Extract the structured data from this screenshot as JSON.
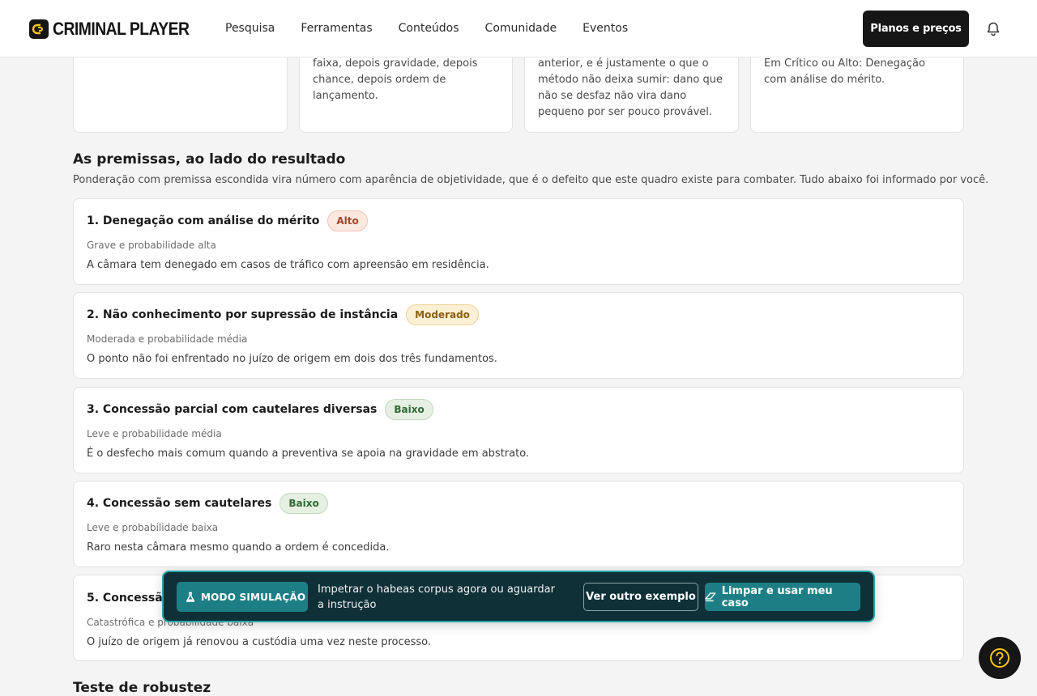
{
  "header": {
    "brand": "CRIMINAL PLAYER",
    "nav": [
      "Pesquisa",
      "Ferramentas",
      "Conteúdos",
      "Comunidade",
      "Eventos"
    ],
    "plans_label": "Planos e preços"
  },
  "top_cards": [
    "",
    "faixa, depois gravidade, depois chance, depois ordem de lançamento.",
    "anterior, e é justamente o que o método não deixa sumir: dano que não se desfaz não vira dano pequeno por ser pouco provável.",
    "Em Crítico ou Alto: Denegação com análise do mérito."
  ],
  "premises": {
    "title": "As premissas, ao lado do resultado",
    "subtitle": "Ponderação com premissa escondida vira número com aparência de objetividade, que é o defeito que este quadro existe para combater. Tudo abaixo foi informado por você.",
    "items": [
      {
        "title": "1. Denegação com análise do mérito",
        "badge": "Alto",
        "level": "alto",
        "meta": "Grave e probabilidade alta",
        "desc": "A câmara tem denegado em casos de tráfico com apreensão em residência."
      },
      {
        "title": "2. Não conhecimento por supressão de instância",
        "badge": "Moderado",
        "level": "moderado",
        "meta": "Moderada e probabilidade média",
        "desc": "O ponto não foi enfrentado no juízo de origem em dois dos três fundamentos."
      },
      {
        "title": "3. Concessão parcial com cautelares diversas",
        "badge": "Baixo",
        "level": "baixo",
        "meta": "Leve e probabilidade média",
        "desc": "É o desfecho mais comum quando a preventiva se apoia na gravidade em abstrato."
      },
      {
        "title": "4. Concessão sem cautelares",
        "badge": "Baixo",
        "level": "baixo",
        "meta": "Leve e probabilidade baixa",
        "desc": "Raro nesta câmara mesmo quando a ordem é concedida."
      },
      {
        "title": "5. Concessão",
        "badge": "",
        "level": "",
        "meta": "Catastrófica e probabilidade baixa",
        "desc": "O juízo de origem já renovou a custódia uma vez neste processo."
      }
    ]
  },
  "robustness_title": "Teste de robustez",
  "simulation": {
    "badge": "MODO SIMULAÇÃO",
    "text": "Impetrar o habeas corpus agora ou aguardar a instrução",
    "other_example": "Ver outro exemplo",
    "clear_use": "Limpar e usar meu caso"
  },
  "colors": {
    "accent": "#1d7f85",
    "sim_bg": "#0f3037",
    "dark": "#161616",
    "help_icon": "#f5c518"
  }
}
